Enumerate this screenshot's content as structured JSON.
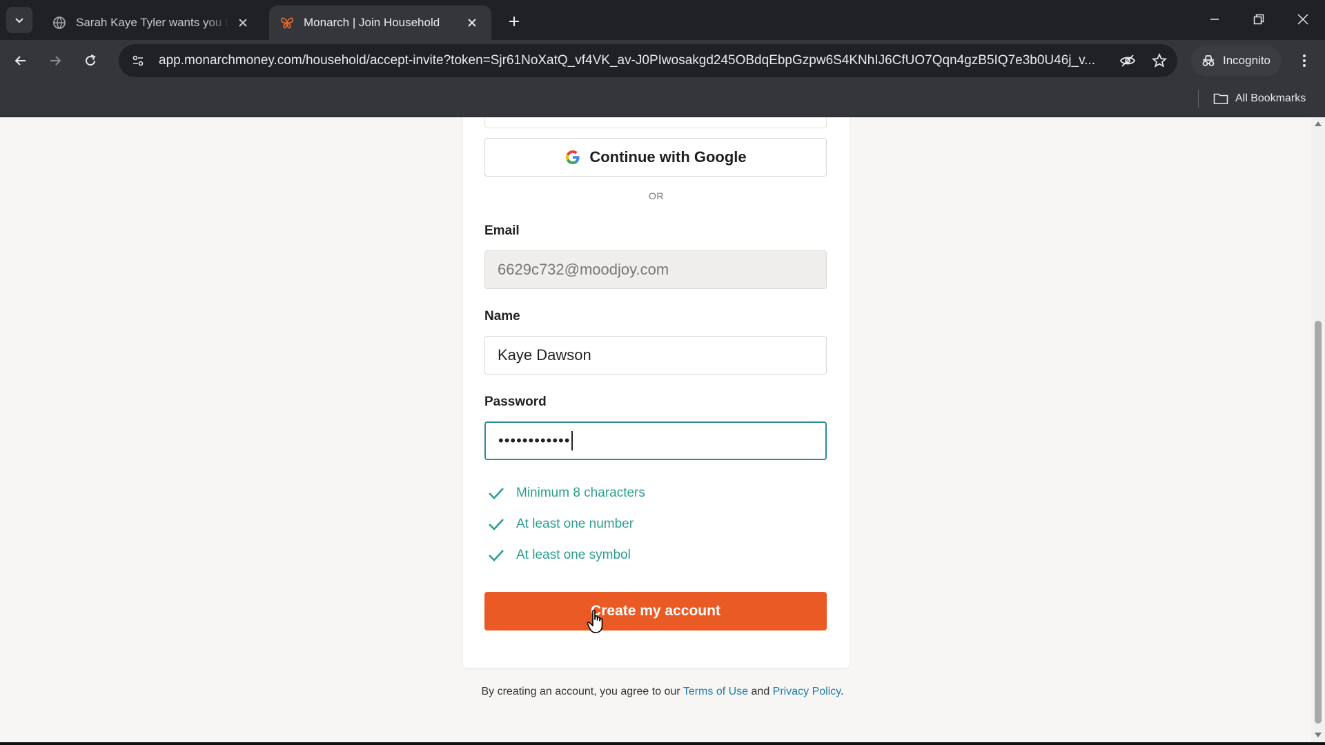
{
  "browser": {
    "tabs": [
      {
        "title": "Sarah Kaye Tyler wants you to join"
      },
      {
        "title": "Monarch | Join Household"
      }
    ],
    "url": "app.monarchmoney.com/household/accept-invite?token=Sjr61NoXatQ_vf4VK_av-J0PIwosakgd245OBdqEbpGzpw6S4KNhIJ6CfUO7Qqn4gzB5IQ7e3b0U46j_v...",
    "incognito_label": "Incognito",
    "bookmarks_label": "All Bookmarks"
  },
  "form": {
    "google_button": "Continue with Google",
    "or_divider": "OR",
    "email_label": "Email",
    "email_value": "6629c732@moodjoy.com",
    "name_label": "Name",
    "name_value": "Kaye Dawson",
    "password_label": "Password",
    "password_masked": "••••••••••••",
    "requirements": [
      "Minimum 8 characters",
      "At least one number",
      "At least one symbol"
    ],
    "submit_label": "Create my account"
  },
  "legal": {
    "prefix": "By creating an account, you agree to our ",
    "terms": "Terms of Use",
    "and": " and ",
    "privacy": "Privacy Policy",
    "suffix": "."
  },
  "colors": {
    "accent_orange": "#ea5a24",
    "success_teal": "#2a9d8f",
    "focus_border": "#2e8b9a",
    "link_blue": "#1d7fa6"
  }
}
